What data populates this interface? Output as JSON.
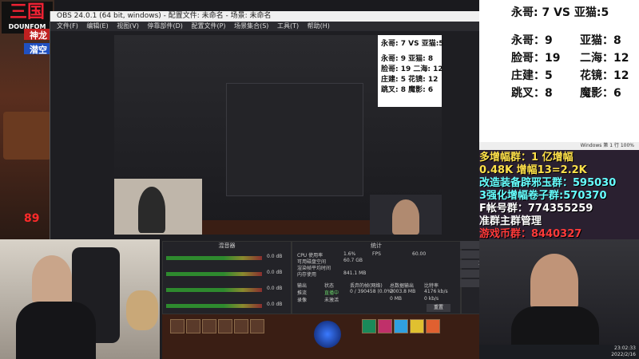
{
  "stream": {
    "logo_main": "三国",
    "logo_sub": "DOUNFOM",
    "badge_top": "神龙",
    "badge_bottom": "潜空",
    "hp_value": "89"
  },
  "obs": {
    "title_bar": "OBS 24.0.1 (64 bit, windows) - 配置文件: 未命名 - 场景: 未命名",
    "menu": [
      "文件(F)",
      "编辑(E)",
      "视图(V)",
      "停靠部件(D)",
      "配置文件(P)",
      "场景集合(S)",
      "工具(T)",
      "帮助(H)"
    ],
    "nested_score": {
      "vs": "永哥: 7  VS   亚猫:5",
      "rows": [
        "永哥: 9   亚猫: 8",
        "脸哥: 19   二海: 12",
        "庄建: 5   花镜: 12",
        "跳叉: 8   魔影: 6"
      ]
    },
    "audio_header": "混音器",
    "stats_header": "统计",
    "controls_header": "控件",
    "controls": [
      "停止推流",
      "开始录制",
      "工作室模式",
      "设置",
      "退出"
    ],
    "stats": {
      "cpu_label": "CPU 使用率",
      "cpu_value": "1.6%",
      "fps_label": "FPS",
      "fps_value": "60.00",
      "disk_label": "可用磁盘空间",
      "disk_value": "60.7 GB",
      "render_label": "渲染帧平均时间",
      "mem_label": "内存使用",
      "mem_value": "841.1 MB",
      "output_h": "输出",
      "status_h": "状态",
      "drop_h": "丢弃的帧(网络)",
      "total_h": "总数据输出",
      "bitrate_h": "比特率",
      "stream_row": [
        "推流",
        "直播中",
        "0 / 390458 (0.0%)",
        "2003.8 MB",
        "4176 kb/s"
      ],
      "record_row": [
        "录像",
        "未激活",
        "",
        "0 MB",
        "0 kb/s"
      ],
      "reset": "重置"
    },
    "audio_levels": [
      "0.0 dB",
      "0.0 dB",
      "0.0 dB",
      "0.0 dB"
    ]
  },
  "scoreboard": {
    "vs_line": "永哥: 7  VS      亚猫:5",
    "players_left": [
      {
        "name": "永哥",
        "score": "9"
      },
      {
        "name": "脸哥",
        "score": "19"
      },
      {
        "name": "庄建",
        "score": "5"
      },
      {
        "name": "跳叉",
        "score": "8"
      }
    ],
    "players_right": [
      {
        "name": "亚猫",
        "score": "8"
      },
      {
        "name": "二海",
        "score": "12"
      },
      {
        "name": "花镜",
        "score": "12"
      },
      {
        "name": "魔影",
        "score": "6"
      }
    ],
    "status": "Windows   第 1 行  100%"
  },
  "ticker": [
    "多增幅群：1 亿增幅",
    "0.48K  增幅13=2.2K",
    "改造装备辟邪玉群：595030",
    "3强化增幅卷子群:570370",
    "F帐号群：774355259",
    "准群主群管理",
    "游戏币群：8440327"
  ],
  "taskbar": {
    "time": "23:02:33",
    "date": "2022/2/16"
  },
  "colors": {
    "accent_red": "#ff2a2a",
    "ticker_yellow": "#ffe14a",
    "ticker_cyan": "#6ff"
  }
}
